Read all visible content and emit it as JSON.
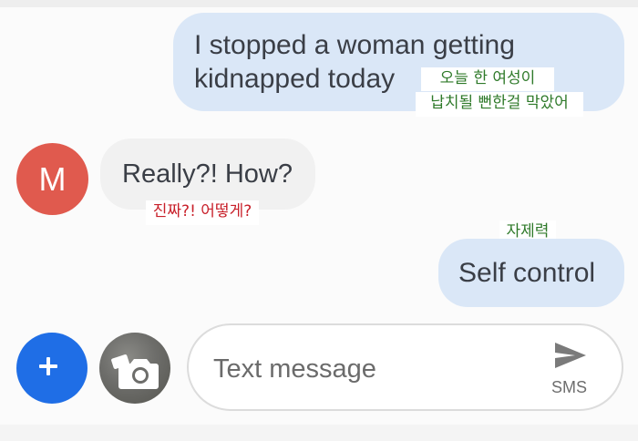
{
  "conversation": {
    "messages": [
      {
        "direction": "outgoing",
        "lines": [
          "I stopped a woman getting",
          "kidnapped today"
        ],
        "translation": [
          "오늘 한 여성이",
          "납치될 뻔한걸 막았어"
        ]
      },
      {
        "direction": "incoming",
        "sender_initial": "M",
        "text": "Really?! How?",
        "translation": "진짜?! 어떻게?"
      },
      {
        "direction": "outgoing",
        "text": "Self control",
        "translation": "자제력"
      }
    ]
  },
  "composer": {
    "placeholder": "Text message",
    "send_label": "SMS",
    "add_icon": "plus-icon",
    "camera_icon": "camera-icon",
    "send_icon": "send-icon"
  },
  "colors": {
    "outgoing_bubble": "#dae7f7",
    "incoming_bubble": "#f1f1f1",
    "avatar": "#e05a4e",
    "add_button": "#1f6ee6",
    "translation_green": "#2f7a2a",
    "translation_red": "#c8202a"
  }
}
